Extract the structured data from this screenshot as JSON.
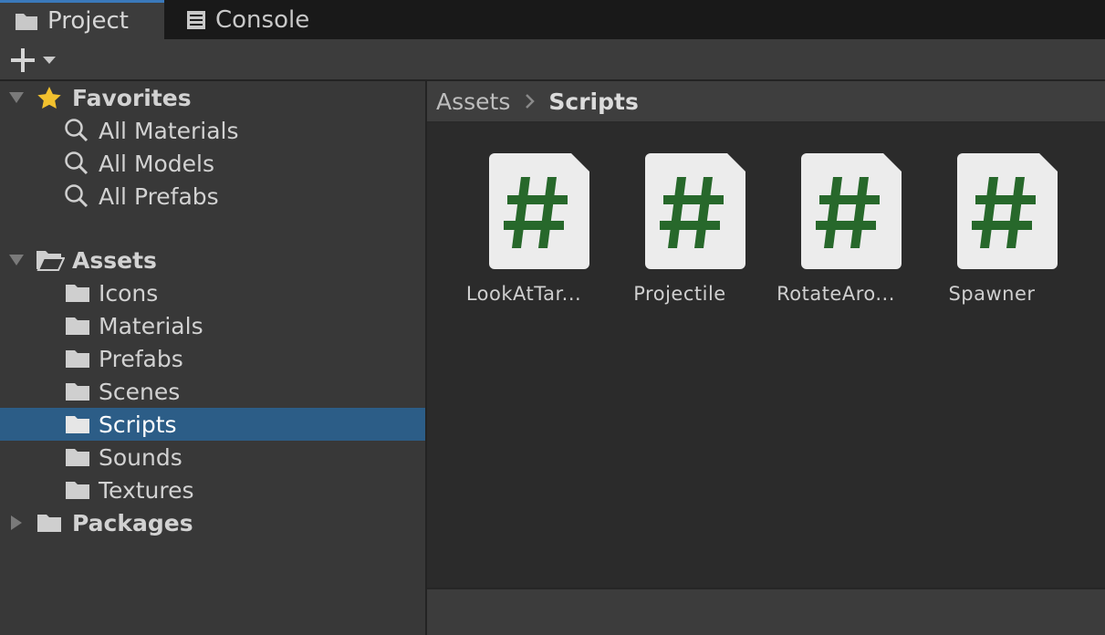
{
  "tabs": [
    {
      "label": "Project",
      "icon": "folder-icon",
      "active": true
    },
    {
      "label": "Console",
      "icon": "console-icon",
      "active": false
    }
  ],
  "toolbar": {
    "add_icon": "plus-icon",
    "dropdown_icon": "caret-down-icon"
  },
  "tree": {
    "favorites": {
      "label": "Favorites",
      "icon": "star-icon",
      "items": [
        "All Materials",
        "All Models",
        "All Prefabs"
      ]
    },
    "assets": {
      "label": "Assets",
      "icon": "open-folder-icon",
      "items": [
        "Icons",
        "Materials",
        "Prefabs",
        "Scenes",
        "Scripts",
        "Sounds",
        "Textures"
      ],
      "selected": "Scripts"
    },
    "packages": {
      "label": "Packages",
      "icon": "folder-icon"
    }
  },
  "breadcrumb": {
    "root": "Assets",
    "current": "Scripts"
  },
  "files": [
    {
      "label": "LookAtTar...",
      "icon": "csharp-script-icon"
    },
    {
      "label": "Projectile",
      "icon": "csharp-script-icon"
    },
    {
      "label": "RotateAro...",
      "icon": "csharp-script-icon"
    },
    {
      "label": "Spawner",
      "icon": "csharp-script-icon"
    }
  ],
  "colors": {
    "selection": "#2c5d87",
    "tab_accent": "#3a79bb",
    "script_hash": "#27682b",
    "star": "#f2c12e"
  }
}
